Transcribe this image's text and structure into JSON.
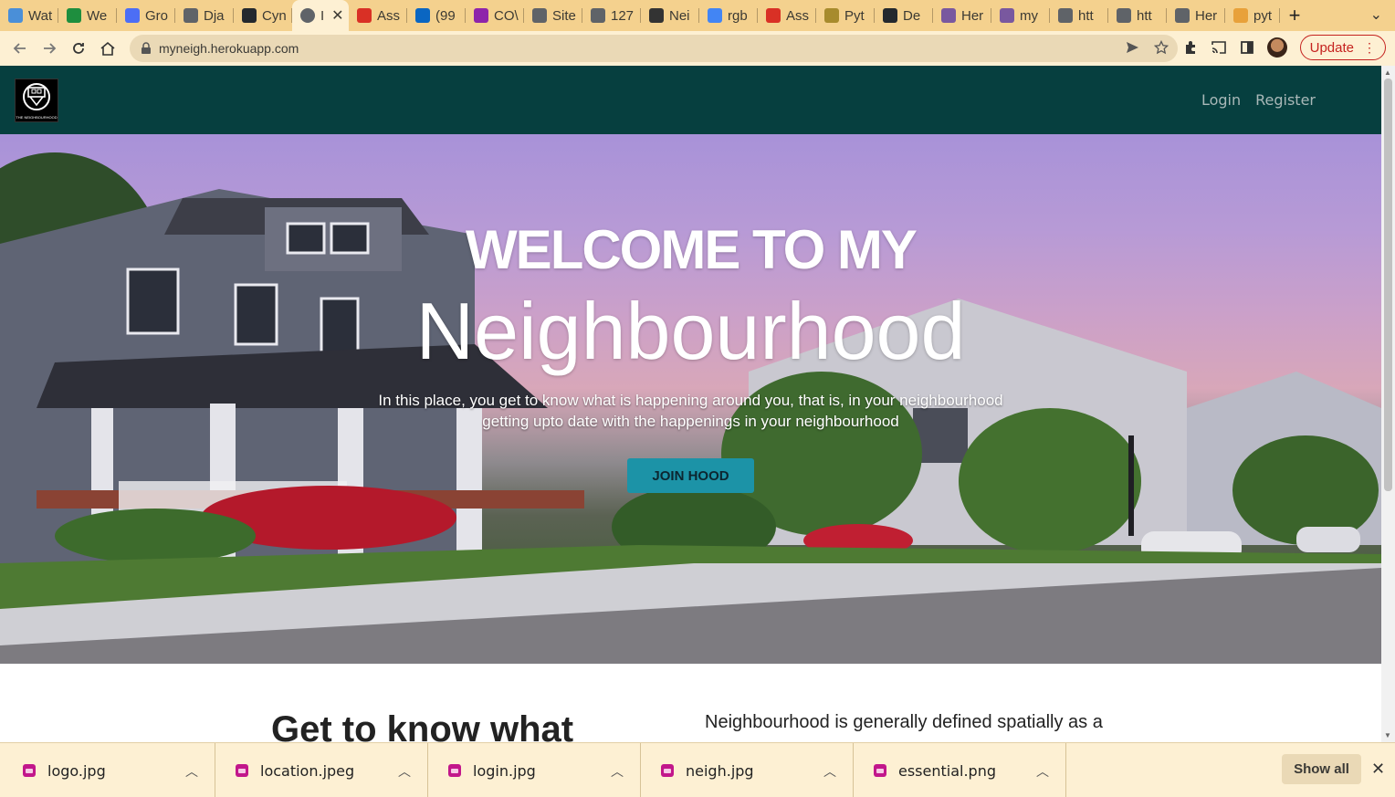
{
  "browser": {
    "tabs": [
      {
        "label": "Wat",
        "color": "#4a8fd8"
      },
      {
        "label": "We",
        "color": "#1e8e3e"
      },
      {
        "label": "Gro",
        "color": "#4c6ef5"
      },
      {
        "label": "Dja",
        "color": "#5f6368"
      },
      {
        "label": "Cyn",
        "color": "#24292e"
      },
      {
        "label": "I",
        "color": "#5f6368",
        "active": true
      },
      {
        "label": "Ass",
        "color": "#d93025"
      },
      {
        "label": "(99",
        "color": "#0a66c2"
      },
      {
        "label": "CO\\",
        "color": "#8e24aa"
      },
      {
        "label": "Site",
        "color": "#5f6368"
      },
      {
        "label": "127",
        "color": "#5f6368"
      },
      {
        "label": "Nei",
        "color": "#333333"
      },
      {
        "label": "rgb",
        "color": "#4285f4"
      },
      {
        "label": "Ass",
        "color": "#d93025"
      },
      {
        "label": "Pyt",
        "color": "#a78b2d"
      },
      {
        "label": "De",
        "color": "#24292e"
      },
      {
        "label": "Her",
        "color": "#79589f"
      },
      {
        "label": "my",
        "color": "#79589f"
      },
      {
        "label": "htt",
        "color": "#5f6368"
      },
      {
        "label": "htt",
        "color": "#5f6368"
      },
      {
        "label": "Her",
        "color": "#5f6368"
      },
      {
        "label": "pyt",
        "color": "#e8a13a"
      }
    ],
    "new_tab": "+",
    "url": "myneigh.herokuapp.com",
    "update_label": "Update"
  },
  "site": {
    "nav": {
      "login": "Login",
      "register": "Register"
    },
    "logo_text": "THE NEIGHBOURHOOD",
    "hero": {
      "line1": "WELCOME TO MY",
      "line2": "Neighbourhood",
      "description_1": "In this place, you get to know what is happening around you, that is, in your neighbourhood",
      "description_2": "getting upto date with the happenings in your neighbourhood",
      "cta": "JOIN HOOD"
    },
    "section": {
      "heading": "Get to know what",
      "text": "Neighbourhood is generally defined spatially as a"
    }
  },
  "downloads": {
    "files": [
      "logo.jpg",
      "location.jpeg",
      "login.jpg",
      "neigh.jpg",
      "essential.png"
    ],
    "show_all": "Show all"
  },
  "colors": {
    "tab_bar": "#f4d18e",
    "toolbar": "#fdf0d3",
    "navbar": "#063f3f",
    "button": "#1c93a7"
  }
}
